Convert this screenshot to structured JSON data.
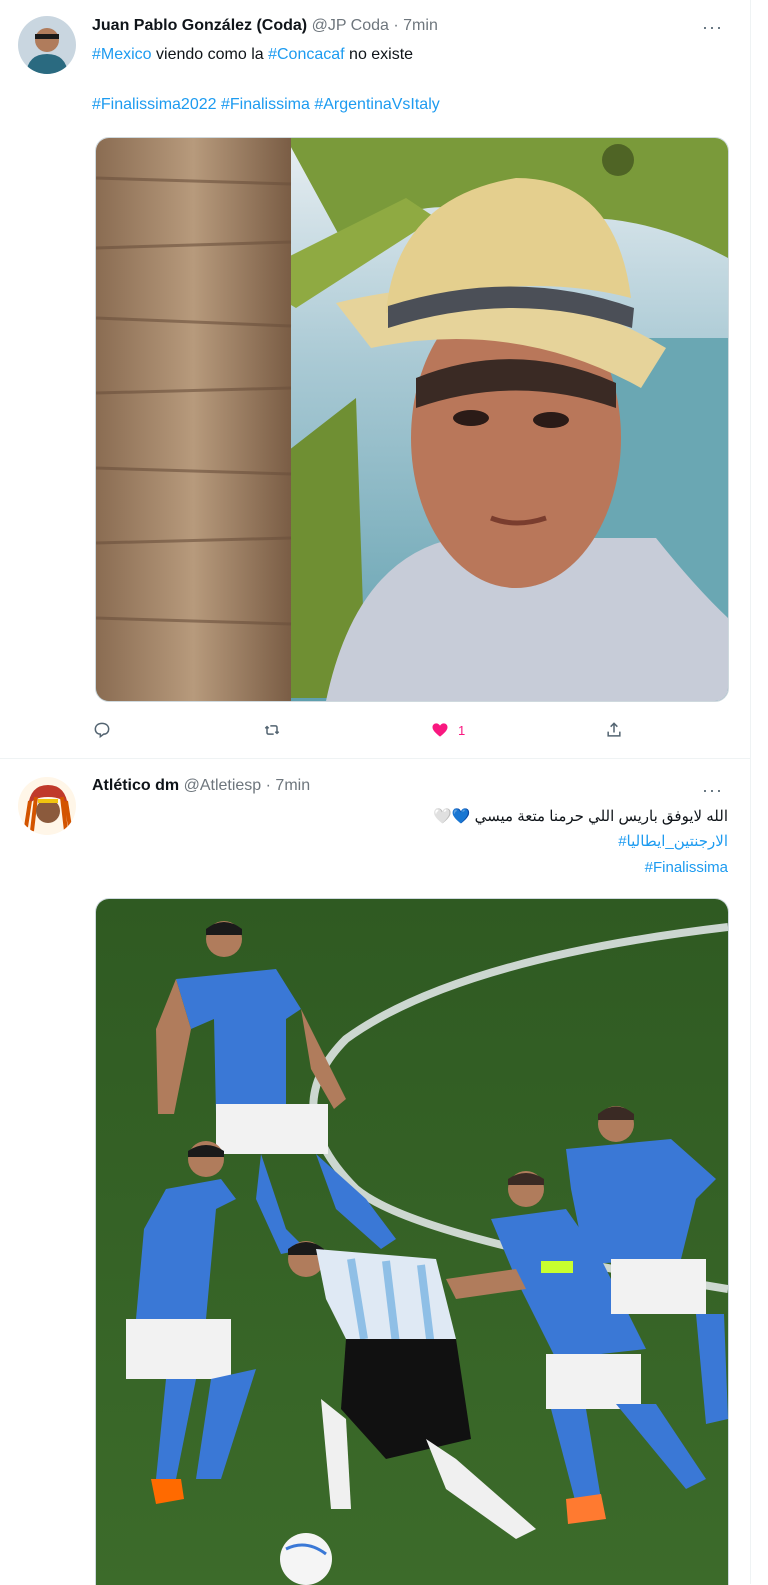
{
  "tweets": [
    {
      "name": "Juan Pablo González (Coda)",
      "handle": "@JP Coda",
      "dot": "·",
      "time": "7min",
      "line1_tag1": "#Mexico",
      "line1_mid": " viendo como la ",
      "line1_tag2": "#Concacaf",
      "line1_end": " no existe",
      "line2_tags": [
        "#Finalissima2022",
        "#Finalissima",
        "#ArgentinaVsItaly"
      ],
      "actions": {
        "reply_icon": "reply-icon",
        "retweet_icon": "retweet-icon",
        "like_icon": "heart-icon",
        "like_count": "1",
        "share_icon": "share-icon"
      }
    },
    {
      "name": "Atlético dm",
      "handle": "@Atletiesp",
      "dot": "·",
      "time": "7min",
      "arabic_text": "الله لايوفق باريس اللي حرمنا متعة ميسي",
      "emoji1": "💙",
      "emoji2": "🤍",
      "tag_arabic": "#الارجنتين_ايطاليا",
      "tag_final": "#Finalissima"
    }
  ],
  "more_label": "···"
}
